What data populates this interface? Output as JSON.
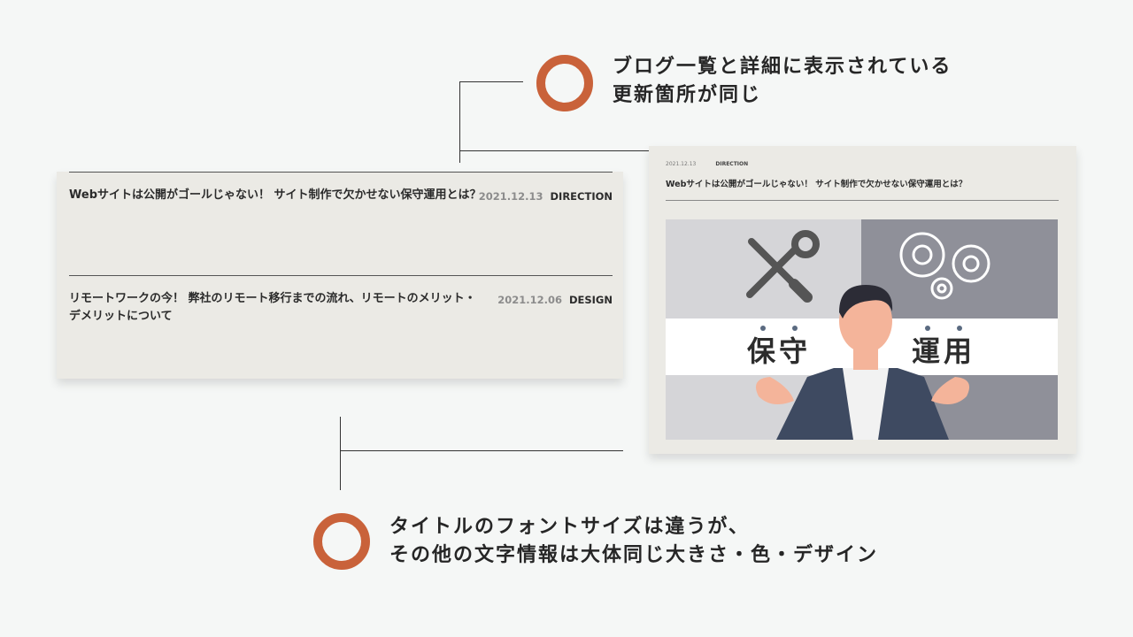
{
  "callout_top": {
    "line1": "ブログ一覧と詳細に表示されている",
    "line2": "更新箇所が同じ"
  },
  "callout_bottom": {
    "line1": "タイトルのフォントサイズは違うが、",
    "line2": "その他の文字情報は大体同じ大きさ・色・デザイン"
  },
  "blog_list": [
    {
      "title": "Webサイトは公開がゴールじゃない！ サイト制作で欠かせない保守運用とは？",
      "date": "2021.12.13",
      "category": "DIRECTION"
    },
    {
      "title": "リモートワークの今！ 弊社のリモート移行までの流れ、リモートのメリット・デメリットについて",
      "date": "2021.12.06",
      "category": "DESIGN"
    }
  ],
  "blog_detail": {
    "date": "2021.12.13",
    "category": "DIRECTION",
    "title": "Webサイトは公開がゴールじゃない！ サイト制作で欠かせない保守運用とは？",
    "eyecatch": {
      "left_word": "保守",
      "right_word": "運用"
    }
  },
  "colors": {
    "accent": "#c9623a",
    "card_bg": "#ebeae5",
    "page_bg": "#f5f7f6"
  }
}
